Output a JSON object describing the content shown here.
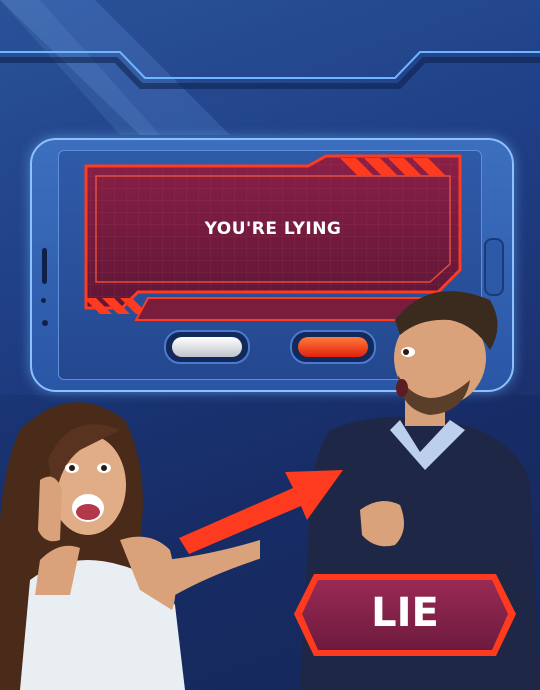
{
  "game_screen": {
    "message": "YOU'RE LYING",
    "buttons": [
      {
        "name": "truth-button",
        "color": "#e8e8e8"
      },
      {
        "name": "lie-button",
        "color": "#ff4a1f"
      }
    ]
  },
  "verdict_badge": {
    "label": "LIE"
  },
  "colors": {
    "background": "#1f3f86",
    "accent_red": "#ff3b1f",
    "panel": "#7a1c3c",
    "frame_blue": "#4a78c6"
  },
  "people": [
    {
      "name": "surprised-woman"
    },
    {
      "name": "surprised-man"
    }
  ]
}
